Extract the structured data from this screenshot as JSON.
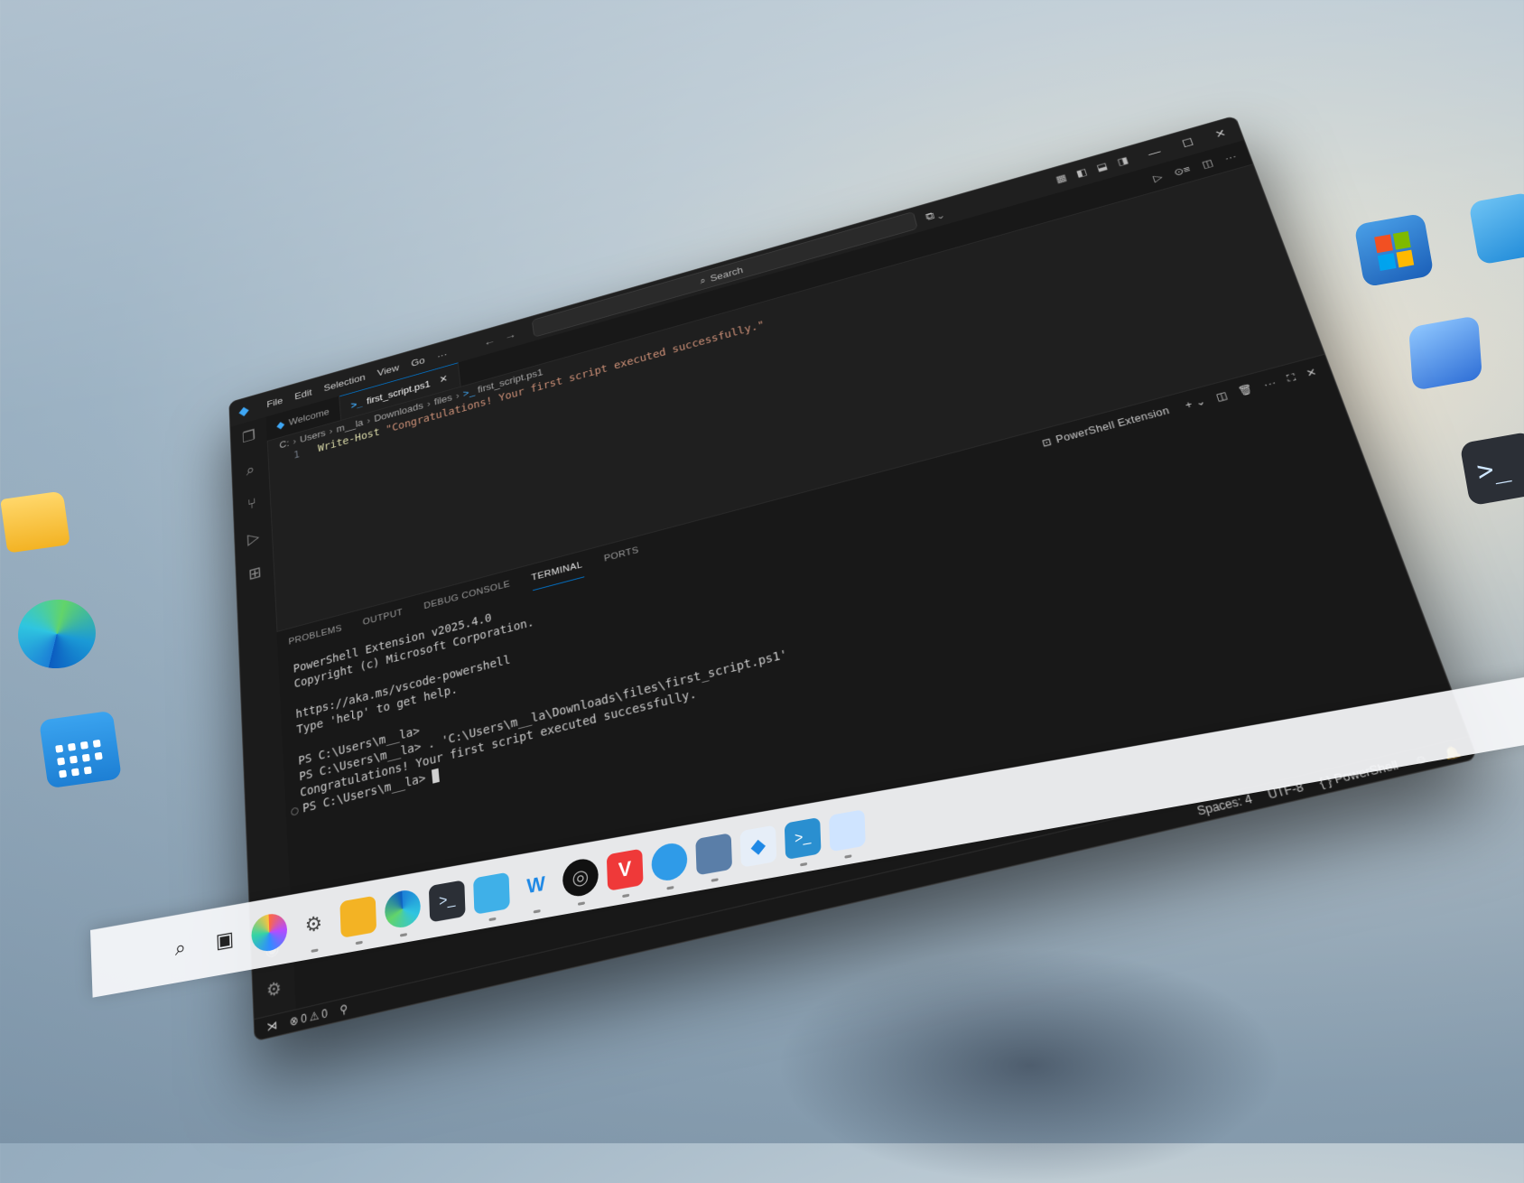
{
  "window": {
    "menu": [
      "File",
      "Edit",
      "Selection",
      "View",
      "Go",
      "···"
    ],
    "search_placeholder": "Search",
    "window_controls": {
      "minimize": "—",
      "maximize": "☐",
      "close": "✕"
    }
  },
  "tabs": [
    {
      "label": "Welcome",
      "icon": "vscode-logo-icon",
      "active": false
    },
    {
      "label": "first_script.ps1",
      "icon": "powershell-icon",
      "active": true,
      "close": "✕"
    }
  ],
  "breadcrumb": [
    "C:",
    "Users",
    "m__la",
    "Downloads",
    "files",
    "first_script.ps1"
  ],
  "editor": {
    "lines": [
      {
        "number": "1",
        "keyword": "Write-Host",
        "string": "\"Congratulations! Your first script executed successfully.\""
      }
    ]
  },
  "panel": {
    "tabs": [
      "PROBLEMS",
      "OUTPUT",
      "DEBUG CONSOLE",
      "TERMINAL",
      "PORTS"
    ],
    "active_tab": "TERMINAL",
    "terminal_name": "PowerShell Extension",
    "terminal_lines": [
      "PowerShell Extension v2025.4.0",
      "Copyright (c) Microsoft Corporation.",
      "",
      "https://aka.ms/vscode-powershell",
      "Type 'help' to get help.",
      "",
      "PS C:\\Users\\m__la>",
      "PS C:\\Users\\m__la> . 'C:\\Users\\m__la\\Downloads\\files\\first_script.ps1'",
      "Congratulations! Your first script executed successfully.",
      "PS C:\\Users\\m__la>"
    ]
  },
  "statusbar": {
    "errors": "0",
    "warnings": "0",
    "spaces": "Spaces: 4",
    "encoding": "UTF-8",
    "language": "PowerShell",
    "language_icon": "{ }"
  },
  "taskbar": {
    "apps": [
      "windows-start",
      "search",
      "task-view",
      "copilot",
      "settings",
      "file-explorer",
      "edge",
      "terminal",
      "notepad",
      "app-w",
      "app-spiral",
      "vivaldi",
      "app-bird",
      "app-installer",
      "vscode",
      "powershell",
      "photos"
    ]
  },
  "colors": {
    "accent": "#0078d4",
    "keyword": "#dcdcaa",
    "string": "#ce9178",
    "editor_bg": "#1f1f1f",
    "panel_bg": "#181818"
  }
}
